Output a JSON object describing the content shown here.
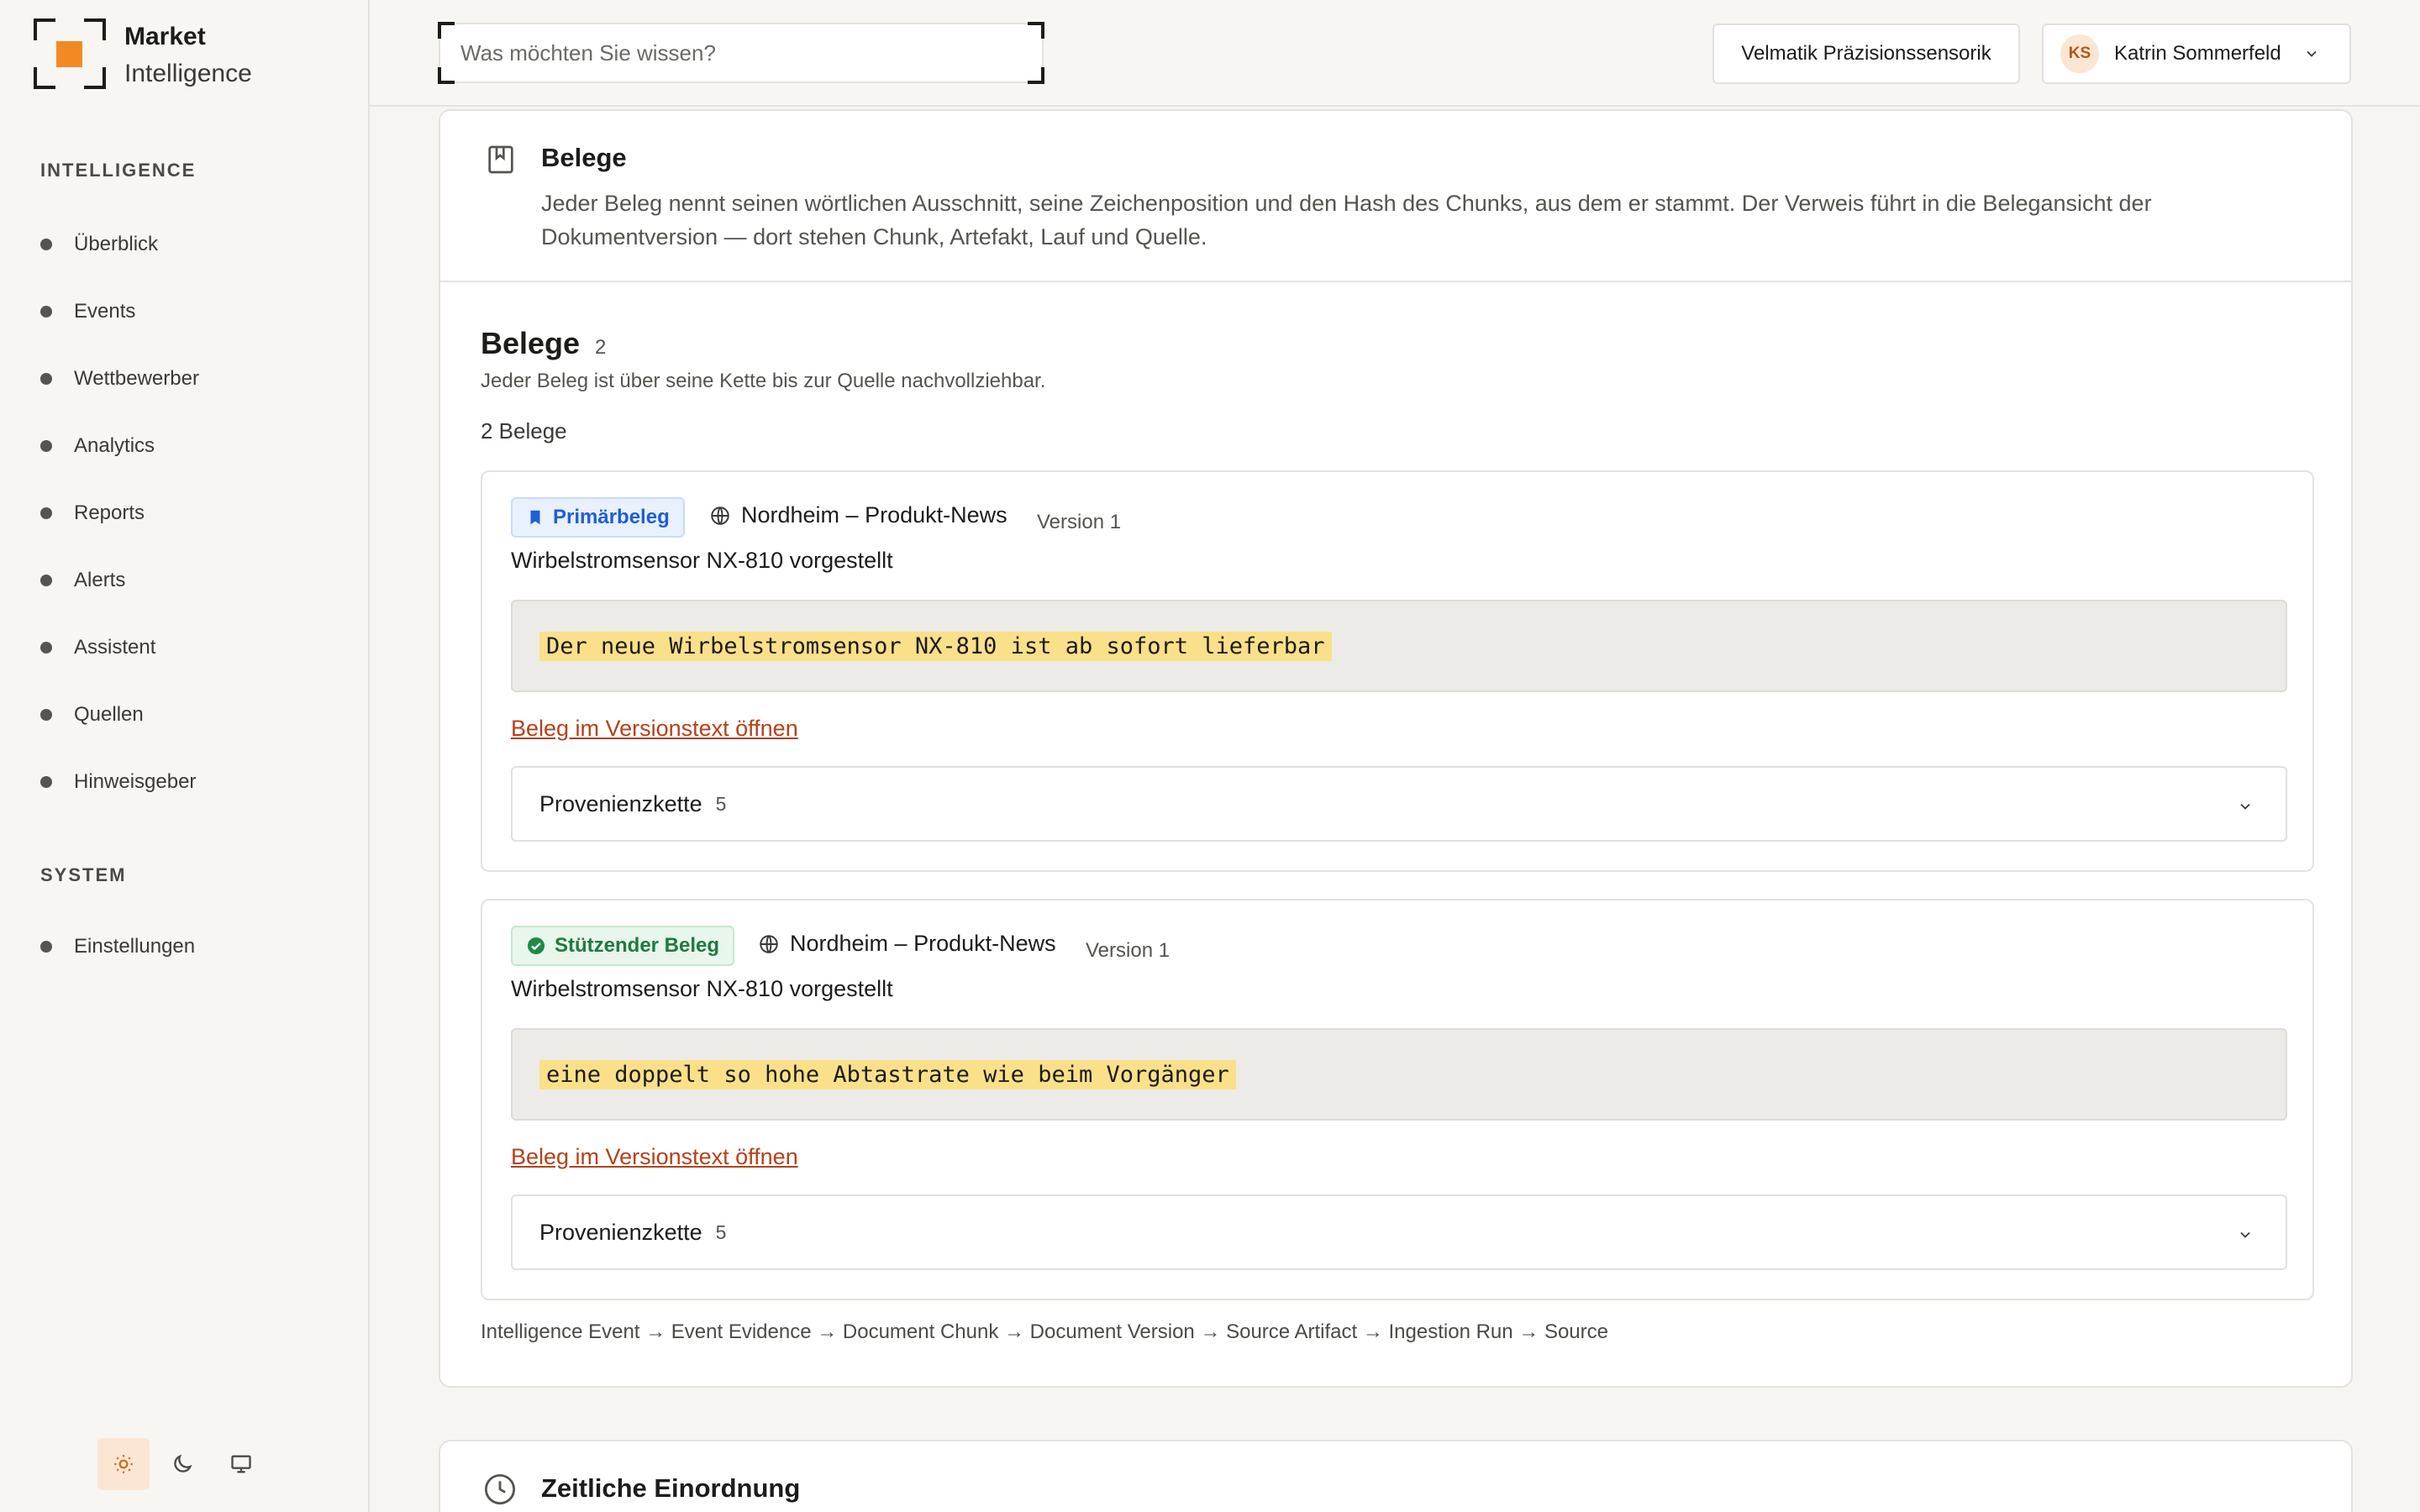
{
  "app": {
    "brand_line1": "Market",
    "brand_line2": "Intelligence",
    "accent_color": "#f28a24"
  },
  "sidebar": {
    "section_intelligence": "INTELLIGENCE",
    "items": [
      {
        "label": "Überblick"
      },
      {
        "label": "Events"
      },
      {
        "label": "Wettbewerber"
      },
      {
        "label": "Analytics"
      },
      {
        "label": "Reports"
      },
      {
        "label": "Alerts"
      },
      {
        "label": "Assistent"
      },
      {
        "label": "Quellen"
      },
      {
        "label": "Hinweisgeber"
      }
    ],
    "section_system": "SYSTEM",
    "system_items": [
      {
        "label": "Einstellungen"
      }
    ],
    "theme": {
      "options": [
        "sun-icon",
        "moon-icon",
        "monitor-icon"
      ],
      "active": "sun-icon"
    }
  },
  "header": {
    "search_placeholder": "Was möchten Sie wissen?",
    "company": "Velmatik Präzisionssensorik",
    "user_initials": "KS",
    "user_name": "Katrin Sommerfeld"
  },
  "evidence_card": {
    "title": "Belege",
    "description": "Jeder Beleg nennt seinen wörtlichen Ausschnitt, seine Zeichenposition und den Hash des Chunks, aus dem er stammt. Der Verweis führt in die Belegansicht der Dokumentversion — dort stehen Chunk, Artefakt, Lauf und Quelle.",
    "section_title": "Belege",
    "section_count": "2",
    "section_subtitle": "Jeder Beleg ist über seine Kette bis zur Quelle nachvollziehbar.",
    "total_label": "2 Belege",
    "items": [
      {
        "badge": "Primärbeleg",
        "source": "Nordheim – Produkt-News",
        "version": "Version 1",
        "title": "Wirbelstromsensor NX-810 vorgestellt",
        "quote": "Der neue Wirbelstromsensor NX-810 ist ab sofort lieferbar",
        "link": "Beleg im Versionstext öffnen",
        "provenance_label": "Provenienzkette",
        "provenance_count": "5"
      },
      {
        "badge": "Stützender Beleg",
        "source": "Nordheim – Produkt-News",
        "version": "Version 1",
        "title": "Wirbelstromsensor NX-810 vorgestellt",
        "quote": "eine doppelt so hohe Abtastrate wie beim Vorgänger",
        "link": "Beleg im Versionstext öffnen",
        "provenance_label": "Provenienzkette",
        "provenance_count": "5"
      }
    ],
    "chain": "Intelligence Event → Event Evidence → Document Chunk → Document Version → Source Artifact → Ingestion Run → Source"
  },
  "timeline_card": {
    "title": "Zeitliche Einordnung"
  }
}
